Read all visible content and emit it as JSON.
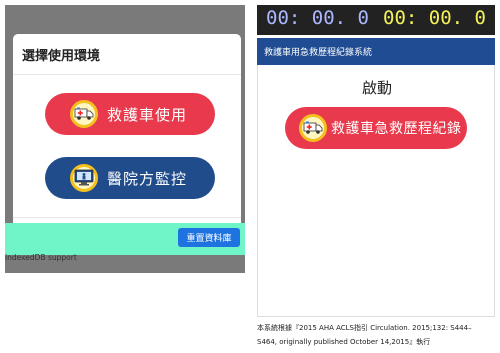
{
  "left": {
    "modal_title": "選擇使用環境",
    "ambulance_button_label": "救護車使用",
    "hospital_button_label": "醫院方監控",
    "reset_button_label": "重置資料庫",
    "indexeddb_text": "indexedDB support"
  },
  "right": {
    "timer_a": "00: 00. 0",
    "timer_b": "00: 00. 0",
    "system_title": "救護車用急救歷程紀錄系統",
    "start_heading": "啟動",
    "record_button_label": "救護車急救歷程紀錄",
    "footer_line1": "本系統根據『2015 AHA ACLS指引 Circulation. 2015;132: S444–",
    "footer_line2": "S464, originally published October 14,2015』執行"
  },
  "colors": {
    "overlay": "#7a7a7a",
    "red_button": "#e83a4c",
    "blue_button": "#214c8c",
    "teal_bar": "#6ff5c8",
    "reset_button": "#1f73e0",
    "title_bar": "#1f4c92",
    "timer_a": "#aab7ff",
    "timer_b": "#f3f05a"
  },
  "icons": {
    "ambulance": "ambulance-icon",
    "hospital_monitor": "hospital-monitor-icon"
  }
}
